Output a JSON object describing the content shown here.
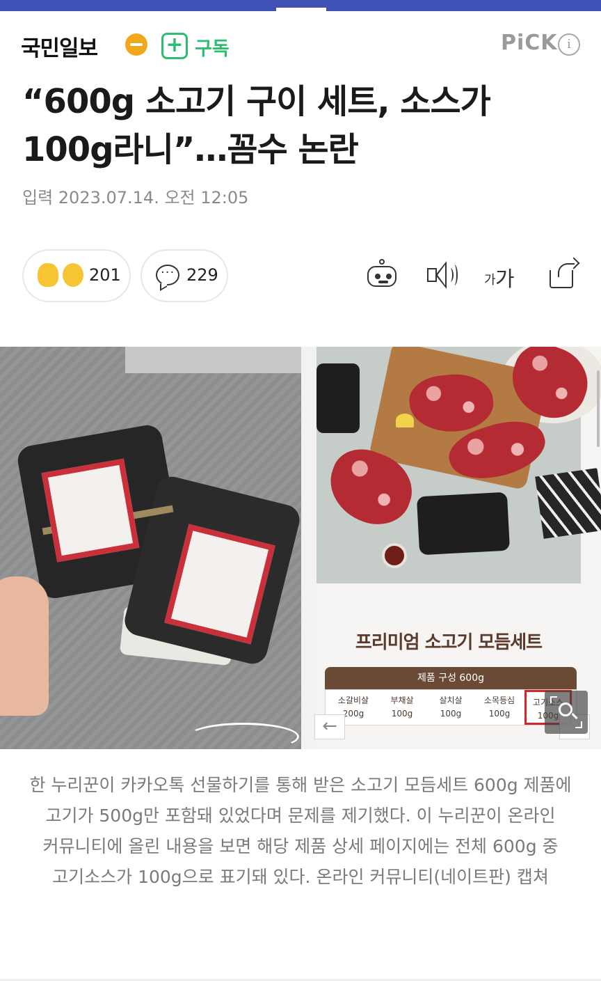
{
  "header": {
    "publisher": "국민일보",
    "subscribe_icon": "+",
    "subscribe_label": "구독",
    "pick_label": "PiCK",
    "info_icon": "i"
  },
  "article": {
    "title": "“600g 소고기 구이 세트, 소스가 100g라니”…꼼수 논란",
    "dateline": "입력 2023.07.14. 오전 12:05"
  },
  "reactions": {
    "reaction_count": "201",
    "comment_count": "229"
  },
  "toolbar": {
    "font_small": "가",
    "font_large": "가"
  },
  "image": {
    "promo_title": "프리미엄 소고기 모듬세트",
    "spec_header": "제품 구성 600g",
    "spec_items": [
      {
        "name": "소갈비살",
        "weight": "200g"
      },
      {
        "name": "부채살",
        "weight": "100g"
      },
      {
        "name": "살치살",
        "weight": "100g"
      },
      {
        "name": "소목등심",
        "weight": "100g"
      },
      {
        "name": "고기소스",
        "weight": "100g"
      }
    ],
    "prev_arrow": "←"
  },
  "caption": "한 누리꾼이 카카오톡 선물하기를 통해 받은 소고기 모듬세트 600g 제품에 고기가 500g만 포함돼 있었다며 문제를 제기했다. 이 누리꾼이 온라인 커뮤니티에 올린 내용을 보면 해당 제품 상세 페이지에는 전체 600g 중 고기소스가 100g으로 표기돼 있다. 온라인 커뮤니티(네이트판) 캡쳐",
  "colors": {
    "brand_green": "#2dbd6e",
    "top_bar": "#3f51b5",
    "highlight_red": "#d0262e"
  },
  "icons": [
    "plus-icon",
    "info-icon",
    "thumbs-up-icon",
    "smile-icon",
    "comment-icon",
    "robot-icon",
    "speaker-icon",
    "font-size-icon",
    "share-icon",
    "zoom-icon",
    "arrow-left-icon",
    "arrow-right-icon"
  ]
}
